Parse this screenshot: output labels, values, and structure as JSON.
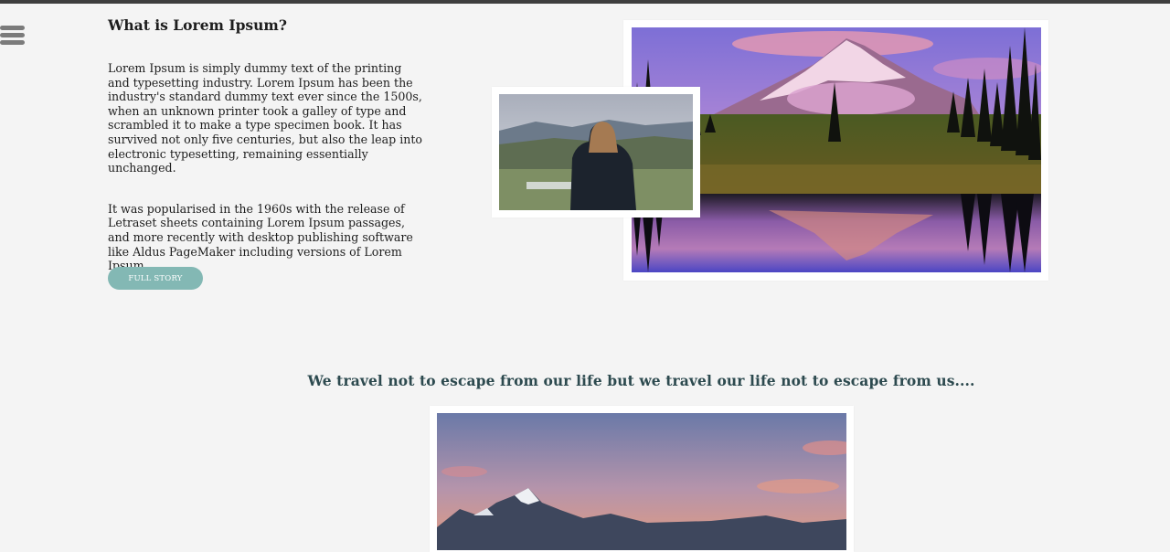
{
  "article": {
    "heading": "What is Lorem Ipsum?",
    "paragraph1": "Lorem Ipsum is simply dummy text of the printing and typesetting industry. Lorem Ipsum has been the industry's standard dummy text ever since the 1500s, when an unknown printer took a galley of type and scrambled it to make a type specimen book. It has survived not only five centuries, but also the leap into electronic typesetting, remaining essentially unchanged.",
    "paragraph2": "It was popularised in the 1960s with the release of Letraset sheets containing Lorem Ipsum passages, and more recently with desktop publishing software like Aldus PageMaker including versions of Lorem Ipsum.",
    "button_label": "FULL STORY"
  },
  "quote": {
    "text": "We travel not to escape from our life but we travel our life not to escape from us...."
  },
  "icons": {
    "menu": "hamburger-menu-icon"
  },
  "colors": {
    "page_background": "#f4f4f4",
    "top_bar": "#3e3e3e",
    "button": "#83b8b4",
    "quote_text": "#2d4a4f",
    "menu_icon": "#7b7b7b"
  }
}
